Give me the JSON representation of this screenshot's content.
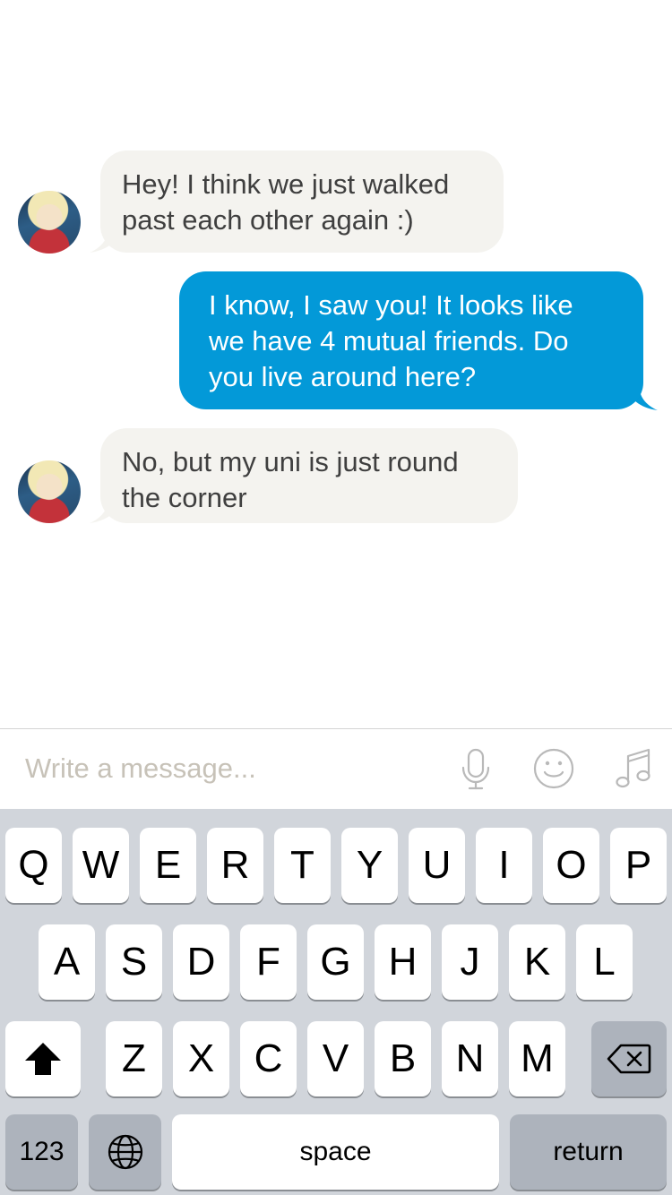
{
  "messages": [
    {
      "from": "them",
      "lines": [
        "Hey! I think we just walked",
        "past each other again :)"
      ]
    },
    {
      "from": "me",
      "lines": [
        "I know, I saw you! It looks like",
        "we have 4 mutual friends. Do",
        "you live around here?"
      ]
    },
    {
      "from": "them",
      "lines": [
        "No, but my uni is just round",
        "the corner"
      ]
    }
  ],
  "composer": {
    "placeholder": "Write a message...",
    "icons": [
      "microphone-icon",
      "emoji-icon",
      "music-icon"
    ]
  },
  "keyboard": {
    "row1": [
      "Q",
      "W",
      "E",
      "R",
      "T",
      "Y",
      "U",
      "I",
      "O",
      "P"
    ],
    "row2": [
      "A",
      "S",
      "D",
      "F",
      "G",
      "H",
      "J",
      "K",
      "L"
    ],
    "row3": [
      "Z",
      "X",
      "C",
      "V",
      "B",
      "N",
      "M"
    ],
    "numbers_label": "123",
    "space_label": "space",
    "return_label": "return",
    "shift_icon": "shift-icon",
    "delete_icon": "backspace-icon",
    "globe_icon": "globe-icon"
  },
  "colors": {
    "outgoing_bubble": "#0399d8",
    "incoming_bubble": "#f4f3ef",
    "keyboard_bg": "#d1d5db"
  }
}
